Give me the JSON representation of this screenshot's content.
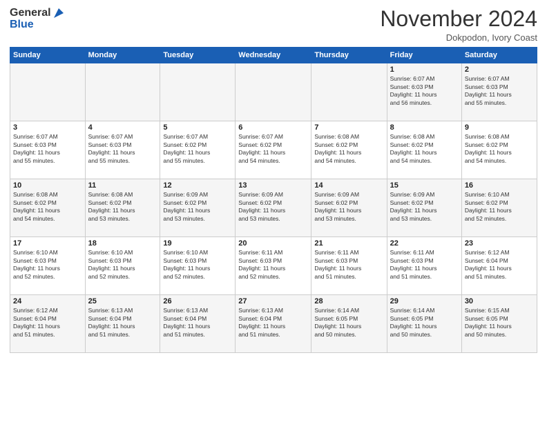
{
  "header": {
    "logo_line1": "General",
    "logo_line2": "Blue",
    "month_title": "November 2024",
    "location": "Dokpodon, Ivory Coast"
  },
  "days_of_week": [
    "Sunday",
    "Monday",
    "Tuesday",
    "Wednesday",
    "Thursday",
    "Friday",
    "Saturday"
  ],
  "weeks": [
    [
      {
        "day": "",
        "info": ""
      },
      {
        "day": "",
        "info": ""
      },
      {
        "day": "",
        "info": ""
      },
      {
        "day": "",
        "info": ""
      },
      {
        "day": "",
        "info": ""
      },
      {
        "day": "1",
        "info": "Sunrise: 6:07 AM\nSunset: 6:03 PM\nDaylight: 11 hours\nand 56 minutes."
      },
      {
        "day": "2",
        "info": "Sunrise: 6:07 AM\nSunset: 6:03 PM\nDaylight: 11 hours\nand 55 minutes."
      }
    ],
    [
      {
        "day": "3",
        "info": "Sunrise: 6:07 AM\nSunset: 6:03 PM\nDaylight: 11 hours\nand 55 minutes."
      },
      {
        "day": "4",
        "info": "Sunrise: 6:07 AM\nSunset: 6:03 PM\nDaylight: 11 hours\nand 55 minutes."
      },
      {
        "day": "5",
        "info": "Sunrise: 6:07 AM\nSunset: 6:02 PM\nDaylight: 11 hours\nand 55 minutes."
      },
      {
        "day": "6",
        "info": "Sunrise: 6:07 AM\nSunset: 6:02 PM\nDaylight: 11 hours\nand 54 minutes."
      },
      {
        "day": "7",
        "info": "Sunrise: 6:08 AM\nSunset: 6:02 PM\nDaylight: 11 hours\nand 54 minutes."
      },
      {
        "day": "8",
        "info": "Sunrise: 6:08 AM\nSunset: 6:02 PM\nDaylight: 11 hours\nand 54 minutes."
      },
      {
        "day": "9",
        "info": "Sunrise: 6:08 AM\nSunset: 6:02 PM\nDaylight: 11 hours\nand 54 minutes."
      }
    ],
    [
      {
        "day": "10",
        "info": "Sunrise: 6:08 AM\nSunset: 6:02 PM\nDaylight: 11 hours\nand 54 minutes."
      },
      {
        "day": "11",
        "info": "Sunrise: 6:08 AM\nSunset: 6:02 PM\nDaylight: 11 hours\nand 53 minutes."
      },
      {
        "day": "12",
        "info": "Sunrise: 6:09 AM\nSunset: 6:02 PM\nDaylight: 11 hours\nand 53 minutes."
      },
      {
        "day": "13",
        "info": "Sunrise: 6:09 AM\nSunset: 6:02 PM\nDaylight: 11 hours\nand 53 minutes."
      },
      {
        "day": "14",
        "info": "Sunrise: 6:09 AM\nSunset: 6:02 PM\nDaylight: 11 hours\nand 53 minutes."
      },
      {
        "day": "15",
        "info": "Sunrise: 6:09 AM\nSunset: 6:02 PM\nDaylight: 11 hours\nand 53 minutes."
      },
      {
        "day": "16",
        "info": "Sunrise: 6:10 AM\nSunset: 6:02 PM\nDaylight: 11 hours\nand 52 minutes."
      }
    ],
    [
      {
        "day": "17",
        "info": "Sunrise: 6:10 AM\nSunset: 6:03 PM\nDaylight: 11 hours\nand 52 minutes."
      },
      {
        "day": "18",
        "info": "Sunrise: 6:10 AM\nSunset: 6:03 PM\nDaylight: 11 hours\nand 52 minutes."
      },
      {
        "day": "19",
        "info": "Sunrise: 6:10 AM\nSunset: 6:03 PM\nDaylight: 11 hours\nand 52 minutes."
      },
      {
        "day": "20",
        "info": "Sunrise: 6:11 AM\nSunset: 6:03 PM\nDaylight: 11 hours\nand 52 minutes."
      },
      {
        "day": "21",
        "info": "Sunrise: 6:11 AM\nSunset: 6:03 PM\nDaylight: 11 hours\nand 51 minutes."
      },
      {
        "day": "22",
        "info": "Sunrise: 6:11 AM\nSunset: 6:03 PM\nDaylight: 11 hours\nand 51 minutes."
      },
      {
        "day": "23",
        "info": "Sunrise: 6:12 AM\nSunset: 6:04 PM\nDaylight: 11 hours\nand 51 minutes."
      }
    ],
    [
      {
        "day": "24",
        "info": "Sunrise: 6:12 AM\nSunset: 6:04 PM\nDaylight: 11 hours\nand 51 minutes."
      },
      {
        "day": "25",
        "info": "Sunrise: 6:13 AM\nSunset: 6:04 PM\nDaylight: 11 hours\nand 51 minutes."
      },
      {
        "day": "26",
        "info": "Sunrise: 6:13 AM\nSunset: 6:04 PM\nDaylight: 11 hours\nand 51 minutes."
      },
      {
        "day": "27",
        "info": "Sunrise: 6:13 AM\nSunset: 6:04 PM\nDaylight: 11 hours\nand 51 minutes."
      },
      {
        "day": "28",
        "info": "Sunrise: 6:14 AM\nSunset: 6:05 PM\nDaylight: 11 hours\nand 50 minutes."
      },
      {
        "day": "29",
        "info": "Sunrise: 6:14 AM\nSunset: 6:05 PM\nDaylight: 11 hours\nand 50 minutes."
      },
      {
        "day": "30",
        "info": "Sunrise: 6:15 AM\nSunset: 6:05 PM\nDaylight: 11 hours\nand 50 minutes."
      }
    ]
  ]
}
